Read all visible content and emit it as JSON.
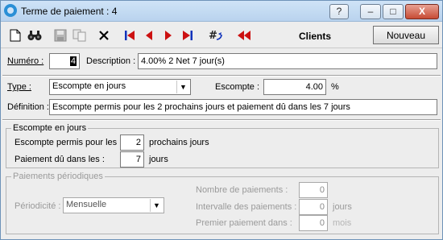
{
  "window": {
    "title": "Terme de paiement : 4"
  },
  "titlebar_buttons": {
    "help": "?",
    "minimize": "–",
    "maximize": "□",
    "close": "X"
  },
  "toolbar": {
    "icons": [
      "new-document-icon",
      "find-binoculars-icon",
      "save-disk-icon",
      "copy-icon",
      "delete-x-icon",
      "first-record-icon",
      "previous-record-icon",
      "next-record-icon",
      "last-record-icon",
      "goto-number-icon",
      "rewind-icon"
    ],
    "context": "Clients",
    "new_button": "Nouveau"
  },
  "colors": {
    "nav_red": "#cc1111",
    "nav_blue": "#1133bb",
    "title_bar": "#b9d3ee"
  },
  "form": {
    "numero": {
      "label": "Numéro :",
      "value": "4"
    },
    "description": {
      "label": "Description :",
      "value": "4.00% 2 Net 7 jour(s)"
    },
    "type": {
      "label": "Type :",
      "value": "Escompte en jours"
    },
    "escompte": {
      "label": "Escompte :",
      "value": "4.00",
      "unit": "%"
    },
    "definition": {
      "label": "Définition :",
      "value": "Escompte permis pour les 2 prochains jours et paiement dû dans les 7 jours"
    }
  },
  "escompte_group": {
    "title": "Escompte en jours",
    "permis": {
      "label": "Escompte permis pour les :",
      "value": "2",
      "suffix": "prochains jours"
    },
    "paiement": {
      "label": "Paiement dû dans les :",
      "value": "7",
      "suffix": "jours"
    }
  },
  "periodic_group": {
    "title": "Paiements périodiques",
    "periodicite": {
      "label": "Périodicité :",
      "value": "Mensuelle"
    },
    "nombre": {
      "label": "Nombre de paiements :",
      "value": "0"
    },
    "intervalle": {
      "label": "Intervalle des paiements :",
      "value": "0",
      "suffix": "jours"
    },
    "premier": {
      "label": "Premier paiement dans :",
      "value": "0",
      "suffix": "mois"
    }
  }
}
